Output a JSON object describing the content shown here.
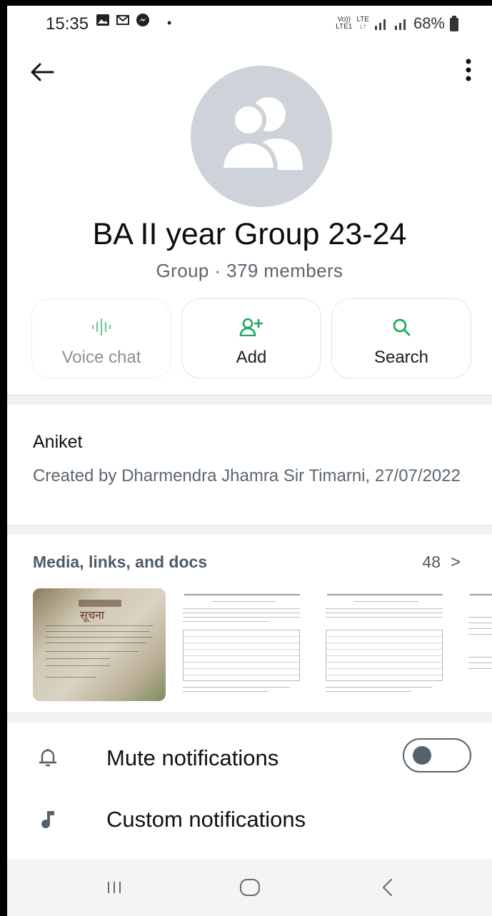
{
  "status_bar": {
    "time": "15:35",
    "dot": "•",
    "volte_top": "Vo))",
    "volte_bottom": "LTE1",
    "lte_top": "LTE",
    "lte_bottom": "↓↑",
    "battery": "68%"
  },
  "group": {
    "name": "BA II year Group 23-24",
    "subtitle": "Group · 379 members"
  },
  "actions": {
    "voice_chat": "Voice chat",
    "add": "Add",
    "search": "Search"
  },
  "description": {
    "text": "Aniket",
    "created": "Created by Dharmendra Jhamra Sir Timarni, 27/07/2022"
  },
  "media": {
    "title": "Media, links, and docs",
    "count": "48",
    "arrow": ">",
    "photo_heading": "सूचना"
  },
  "notifications": {
    "mute_label": "Mute notifications",
    "mute_enabled": false,
    "custom_label": "Custom notifications"
  },
  "colors": {
    "accent_green": "#1daa61",
    "icon_gray": "#56626c",
    "avatar_bg": "#cdd3d8"
  },
  "icons": [
    "back-arrow-icon",
    "more-vert-icon",
    "group-avatar-icon",
    "voice-wave-icon",
    "add-person-icon",
    "search-icon",
    "bell-icon",
    "music-note-icon",
    "recents-icon",
    "home-icon",
    "nav-back-icon"
  ]
}
